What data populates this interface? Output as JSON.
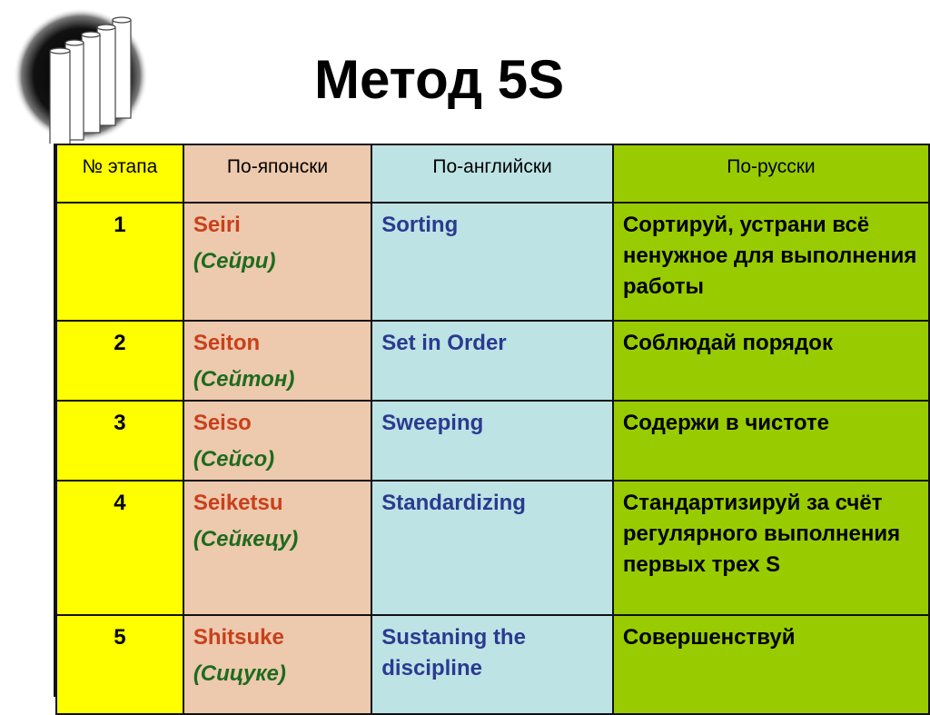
{
  "title": "Метод 5S",
  "logo": {
    "icon": "five-pillars-icon"
  },
  "table": {
    "headers": [
      "№ этапа",
      "По-японски",
      "По-английски",
      "По-русски"
    ],
    "rows": [
      {
        "num": "1",
        "jp": "Seiri",
        "jp_ru": "(Сейри)",
        "en": "Sorting",
        "ru": "Сортируй, устрани всё  ненужное для выполнения работы"
      },
      {
        "num": "2",
        "jp": "Seiton",
        "jp_ru": "(Сейтон)",
        "en": "Set in Order",
        "ru": "Соблюдай порядок"
      },
      {
        "num": "3",
        "jp": "Seiso",
        "jp_ru": "(Сейсо)",
        "en": "Sweeping",
        "ru": "Содержи в чистоте"
      },
      {
        "num": "4",
        "jp": "Seiketsu",
        "jp_ru": "(Сейкецу)",
        "en": "Standardizing",
        "ru": "Стандартизируй за счёт регулярного выполнения первых трех S"
      },
      {
        "num": "5",
        "jp": "Shitsuke",
        "jp_ru": "(Сицуке)",
        "en": "Sustaning the discipline",
        "ru": "Совершенствуй"
      }
    ]
  },
  "colors": {
    "stage_col": "#ffff00",
    "japanese_col": "#edc9ae",
    "english_col": "#bde3e5",
    "russian_col": "#99cc00",
    "japanese_text": "#c8401a",
    "japanese_ru_text": "#1e6b1e",
    "english_text": "#2b3a8f"
  }
}
